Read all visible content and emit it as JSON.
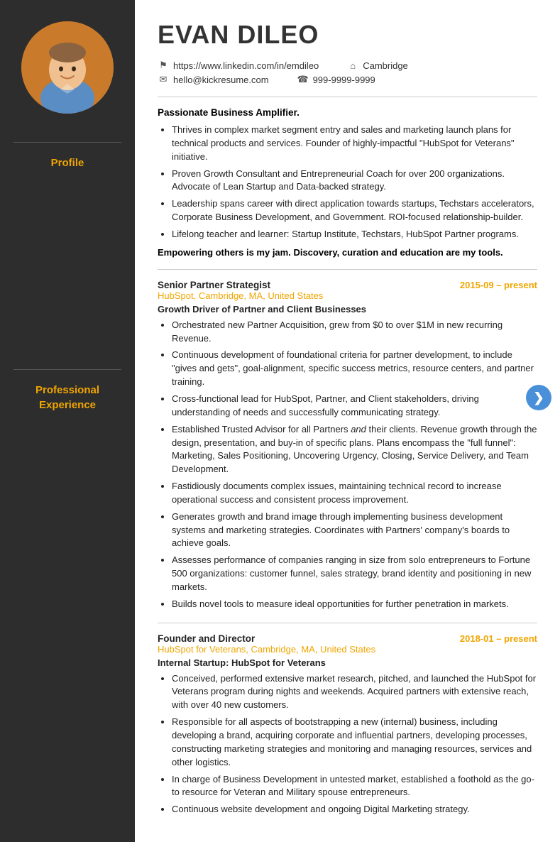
{
  "sidebar": {
    "profile_label": "Profile",
    "experience_label": "Professional\nExperience"
  },
  "header": {
    "name": "EVAN DILEO",
    "linkedin": "https://www.linkedin.com/in/emdileo",
    "email": "hello@kickresume.com",
    "location": "Cambridge",
    "phone": "999-9999-9999"
  },
  "profile": {
    "tagline": "Passionate Business Amplifier.",
    "bullets": [
      "Thrives in complex market segment entry and sales and marketing launch plans for technical products and services.  Founder of highly-impactful \"HubSpot for Veterans\" initiative.",
      "Proven Growth Consultant and Entrepreneurial Coach for over 200 organizations. Advocate of Lean Startup and Data-backed strategy.",
      "Leadership spans career with direct application towards startups, Techstars accelerators, Corporate Business Development, and Government. ROI-focused relationship-builder.",
      "Lifelong teacher and learner:  Startup Institute, Techstars, HubSpot Partner programs."
    ],
    "closing": "Empowering others is my jam.  Discovery, curation and education are my tools."
  },
  "experience": [
    {
      "title": "Senior Partner Strategist",
      "dates": "2015-09 – present",
      "company": "HubSpot, Cambridge, MA, United States",
      "subtitle": "Growth Driver of Partner and Client Businesses",
      "bullets": [
        "Orchestrated new Partner Acquisition, grew from $0 to over $1M in new recurring Revenue.",
        "Continuous development of foundational criteria for partner development, to include \"gives and gets\", goal-alignment, specific success metrics, resource centers, and partner training.",
        "Cross-functional lead for HubSpot, Partner, and Client stakeholders, driving understanding of needs and successfully communicating strategy.",
        "Established Trusted Advisor for all Partners and their clients. Revenue growth through the design, presentation, and buy-in of specific plans.  Plans encompass the \"full funnel\": Marketing, Sales Positioning, Uncovering Urgency, Closing, Service Delivery, and Team Development.",
        "Fastidiously documents complex issues, maintaining technical record to increase operational success and consistent process improvement.",
        "Generates growth and brand image through implementing business development systems and marketing strategies.  Coordinates with Partners' company's boards to achieve goals.",
        "Assesses performance of companies ranging in size from solo entrepreneurs to Fortune 500 organizations: customer funnel, sales strategy, brand identity and positioning in new markets.",
        "Builds novel tools to measure ideal opportunities for further penetration in markets."
      ]
    },
    {
      "title": "Founder and Director",
      "dates": "2018-01 – present",
      "company": "HubSpot for Veterans, Cambridge, MA, United States",
      "subtitle": "Internal Startup: HubSpot for Veterans",
      "bullets": [
        "Conceived, performed extensive market research, pitched, and launched the HubSpot for Veterans program during nights and weekends.  Acquired partners with extensive reach, with over 40 new customers.",
        "Responsible for all aspects of bootstrapping a new (internal) business, including developing a brand, acquiring corporate and influential partners, developing processes, constructing marketing strategies and monitoring and managing resources, services and other logistics.",
        "In charge of Business Development in untested market, established a foothold as the go-to resource for Veteran and Military spouse entrepreneurs.",
        "Continuous website development and ongoing Digital Marketing strategy."
      ]
    }
  ],
  "scroll_btn": {
    "label": "❯"
  }
}
